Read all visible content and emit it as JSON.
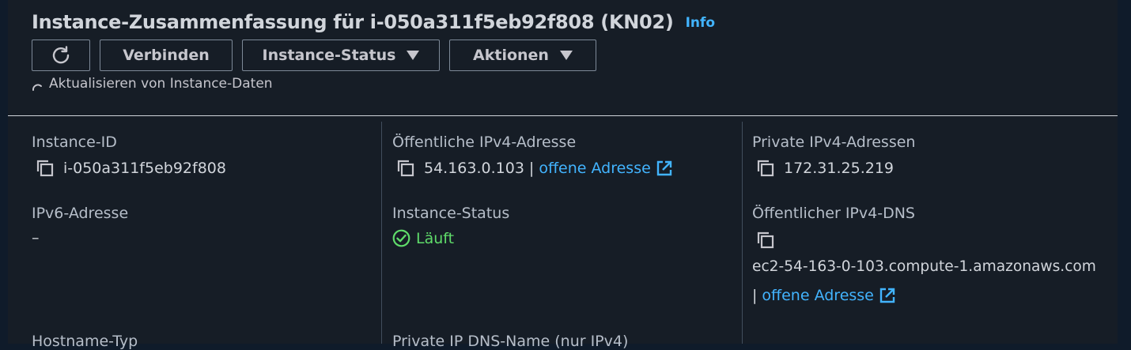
{
  "header": {
    "title": "Instance-Zusammenfassung für i-050a311f5eb92f808 (KN02)",
    "info_label": "Info"
  },
  "toolbar": {
    "refresh_icon": "refresh-icon",
    "connect_label": "Verbinden",
    "instance_status_label": "Instance-Status",
    "actions_label": "Aktionen"
  },
  "refresh_note": "Aktualisieren von Instance-Daten",
  "details": {
    "instance_id": {
      "label": "Instance-ID",
      "value": "i-050a311f5eb92f808"
    },
    "public_ipv4": {
      "label": "Öffentliche IPv4-Adresse",
      "value": "54.163.0.103",
      "separator": "|",
      "link": "offene Adresse"
    },
    "private_ipv4": {
      "label": "Private IPv4-Adressen",
      "value": "172.31.25.219"
    },
    "ipv6": {
      "label": "IPv6-Adresse",
      "value": "–"
    },
    "instance_state": {
      "label": "Instance-Status",
      "value": "Läuft"
    },
    "public_dns": {
      "label": "Öffentlicher IPv4-DNS",
      "value": "ec2-54-163-0-103.compute-1.amazonaws.com",
      "separator": "|",
      "link": "offene Adresse"
    },
    "hostname_type": {
      "label": "Hostname-Typ"
    },
    "private_dns": {
      "label": "Private IP DNS-Name (nur IPv4)"
    }
  },
  "colors": {
    "background": "#161d26",
    "text": "#d1d5db",
    "label": "#b6bec9",
    "link": "#42b4ff",
    "success": "#5fdc6a",
    "border": "#7d8998"
  }
}
